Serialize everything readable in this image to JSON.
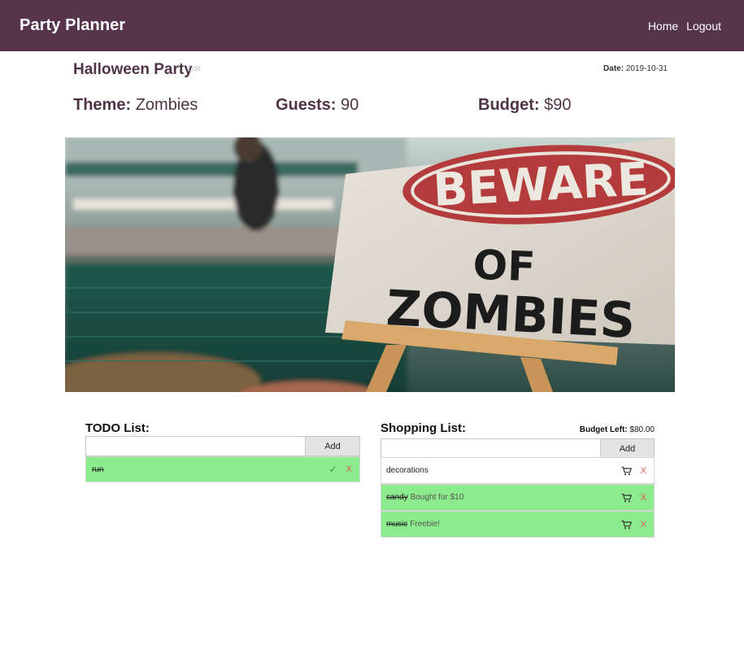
{
  "navbar": {
    "brand": "Party Planner",
    "links": {
      "home": "Home",
      "logout": "Logout"
    },
    "background": "#55344c"
  },
  "party": {
    "title": "Halloween Party",
    "edit_label": "Edit",
    "date_label": "Date:",
    "date": "2019-10-31",
    "theme_label": "Theme:",
    "theme": "Zombies",
    "guests_label": "Guests:",
    "guests": "90",
    "budget_label": "Budget:",
    "budget": "$90"
  },
  "hero_image": {
    "sign_line_1": "BEWARE",
    "sign_line_2": "OF",
    "sign_line_3": "ZOMBIES"
  },
  "todo": {
    "title": "TODO List:",
    "input_value": "",
    "add_label": "Add",
    "items": [
      {
        "name": "run",
        "done": true,
        "check_icon": "✓",
        "remove_icon": "X"
      }
    ]
  },
  "shopping": {
    "title": "Shopping List:",
    "budget_left_label": "Budget Left:",
    "budget_left": "$80.00",
    "input_value": "",
    "add_label": "Add",
    "items": [
      {
        "name": "decorations",
        "note": "",
        "done": false,
        "remove_icon": "X"
      },
      {
        "name": "candy",
        "note": "Bought for $10",
        "done": true,
        "remove_icon": "X"
      },
      {
        "name": "music",
        "note": "Freebie!",
        "done": true,
        "remove_icon": "X"
      }
    ]
  },
  "colors": {
    "accent": "#55344c",
    "heading": "#4e3446",
    "done_row": "#8ceb8c",
    "remove": "#e15a5a",
    "check": "#2f9a2f"
  }
}
